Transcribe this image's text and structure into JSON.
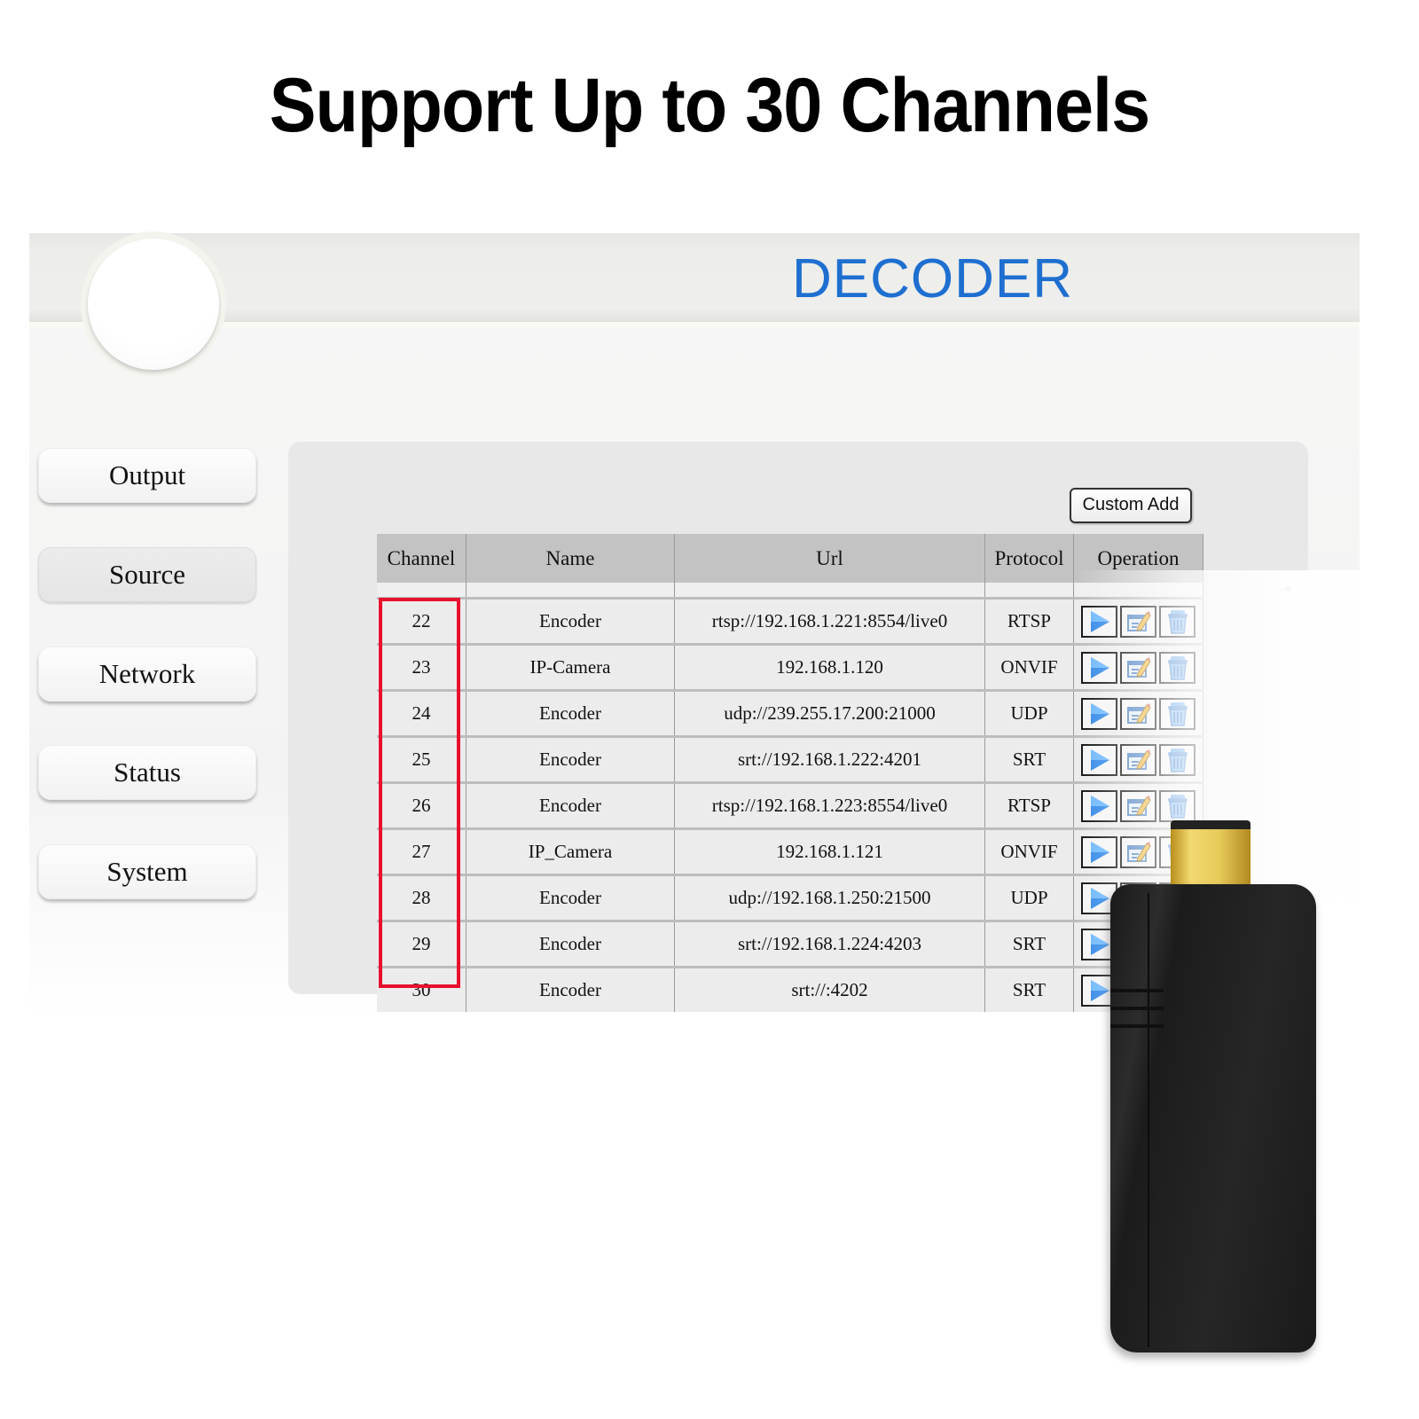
{
  "headline": "Support Up to 30 Channels",
  "app": {
    "title": "DECODER",
    "title_color": "#1e6fd0"
  },
  "nav": {
    "items": [
      {
        "label": "Output",
        "active": false
      },
      {
        "label": "Source",
        "active": true
      },
      {
        "label": "Network",
        "active": false
      },
      {
        "label": "Status",
        "active": false
      },
      {
        "label": "System",
        "active": false
      }
    ]
  },
  "source_panel": {
    "custom_add_label": "Custom Add",
    "columns": [
      "Channel",
      "Name",
      "Url",
      "Protocol",
      "Operation"
    ],
    "rows": [
      {
        "channel": "22",
        "name": "Encoder",
        "url": "rtsp://192.168.1.221:8554/live0",
        "protocol": "RTSP"
      },
      {
        "channel": "23",
        "name": "IP-Camera",
        "url": "192.168.1.120",
        "protocol": "ONVIF"
      },
      {
        "channel": "24",
        "name": "Encoder",
        "url": "udp://239.255.17.200:21000",
        "protocol": "UDP"
      },
      {
        "channel": "25",
        "name": "Encoder",
        "url": "srt://192.168.1.222:4201",
        "protocol": "SRT"
      },
      {
        "channel": "26",
        "name": "Encoder",
        "url": "rtsp://192.168.1.223:8554/live0",
        "protocol": "RTSP"
      },
      {
        "channel": "27",
        "name": "IP_Camera",
        "url": "192.168.1.121",
        "protocol": "ONVIF"
      },
      {
        "channel": "28",
        "name": "Encoder",
        "url": "udp://192.168.1.250:21500",
        "protocol": "UDP"
      },
      {
        "channel": "29",
        "name": "Encoder",
        "url": "srt://192.168.1.224:4203",
        "protocol": "SRT"
      },
      {
        "channel": "30",
        "name": "Encoder",
        "url": "srt://:4202",
        "protocol": "SRT"
      }
    ],
    "operations": [
      "play-icon",
      "edit-icon",
      "delete-icon"
    ],
    "highlight_color": "#e8112d"
  }
}
